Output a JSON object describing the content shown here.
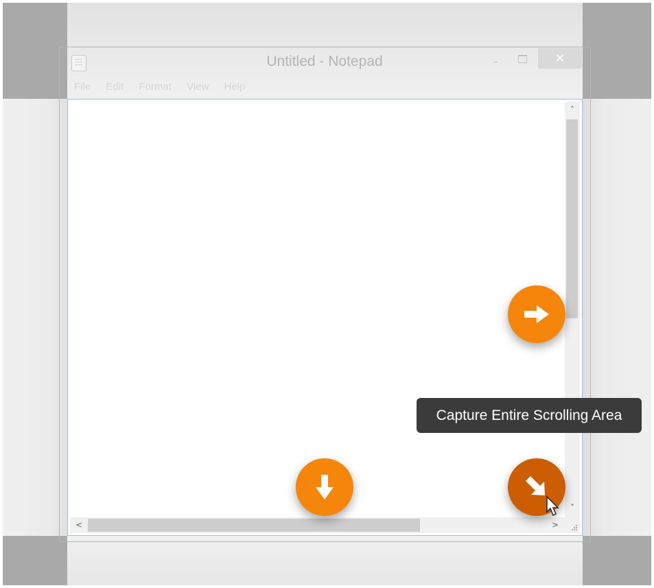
{
  "window": {
    "title": "Untitled - Notepad",
    "minimize_glyph": "–",
    "close_glyph": "✕",
    "menu": [
      "File",
      "Edit",
      "Format",
      "View",
      "Help"
    ]
  },
  "scrollbars": {
    "up_glyph": "˄",
    "down_glyph": "˅",
    "left_glyph": "<",
    "right_glyph": ">"
  },
  "capture_controls": {
    "tooltip": "Capture Entire Scrolling Area",
    "buttons": [
      {
        "name": "capture-horizontal",
        "icon": "arrow-right-icon"
      },
      {
        "name": "capture-vertical",
        "icon": "arrow-down-icon"
      },
      {
        "name": "capture-entire-area",
        "icon": "arrow-diagonal-icon",
        "state": "hovered"
      }
    ]
  },
  "colors": {
    "accent_orange": "#f5860b",
    "accent_orange_active": "#cc5d03",
    "selection_border": "#97bff0",
    "tooltip_bg": "#3b3b3b"
  }
}
